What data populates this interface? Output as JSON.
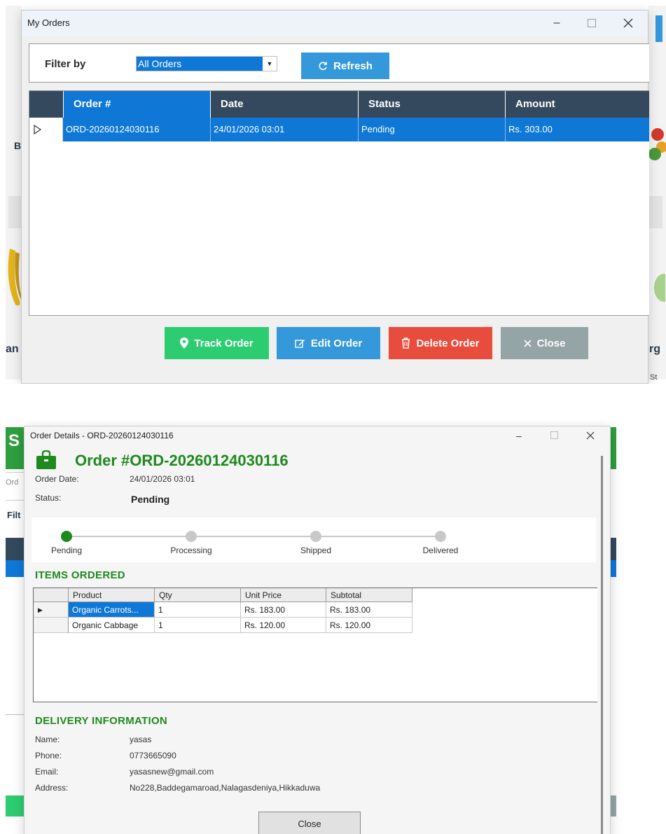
{
  "orders_window": {
    "title": "My Orders",
    "filter_label": "Filter by",
    "filter_value": "All Orders",
    "refresh_label": "Refresh",
    "columns": [
      "Order #",
      "Date",
      "Status",
      "Amount"
    ],
    "rows": [
      {
        "order": "ORD-20260124030116",
        "date": "24/01/2026 03:01",
        "status": "Pending",
        "amount": "Rs. 303.00"
      }
    ],
    "buttons": {
      "track": "Track Order",
      "edit": "Edit Order",
      "delete": "Delete Order",
      "close": "Close"
    },
    "background_text": {
      "left_b": "B",
      "left_an": "an",
      "right_rg": "rg",
      "right_st": "St"
    }
  },
  "details_window": {
    "title": "Order Details - ORD-20260124030116",
    "heading": "Order #ORD-20260124030116",
    "order_date_label": "Order Date:",
    "order_date": "24/01/2026 03:01",
    "status_label": "Status:",
    "status": "Pending",
    "steps": [
      "Pending",
      "Processing",
      "Shipped",
      "Delivered"
    ],
    "active_step": 0,
    "items_heading": "ITEMS ORDERED",
    "item_columns": [
      "Product",
      "Qty",
      "Unit Price",
      "Subtotal"
    ],
    "items": [
      {
        "product": "Organic Carrots...",
        "qty": "1",
        "unit_price": "Rs. 183.00",
        "subtotal": "Rs. 183.00"
      },
      {
        "product": "Organic Cabbage",
        "qty": "1",
        "unit_price": "Rs. 120.00",
        "subtotal": "Rs. 120.00"
      }
    ],
    "delivery_heading": "DELIVERY INFORMATION",
    "delivery": {
      "name_label": "Name:",
      "name": "yasas",
      "phone_label": "Phone:",
      "phone": "0773665090",
      "email_label": "Email:",
      "email": "yasasnew@gmail.com",
      "address_label": "Address:",
      "address": "No228,Baddegamaroad,Nalagasdeniya,Hikkaduwa"
    },
    "close_label": "Close",
    "background_text": {
      "left_s": "S",
      "left_ord": "Ord",
      "left_filt": "Filt"
    }
  },
  "colors": {
    "primary_blue": "#0f78d7",
    "header_dark": "#34495e",
    "track_green": "#2ecc71",
    "edit_blue": "#3498db",
    "delete_red": "#e74c3c",
    "close_gray": "#95a5a6",
    "heading_green": "#1e8a1e"
  }
}
